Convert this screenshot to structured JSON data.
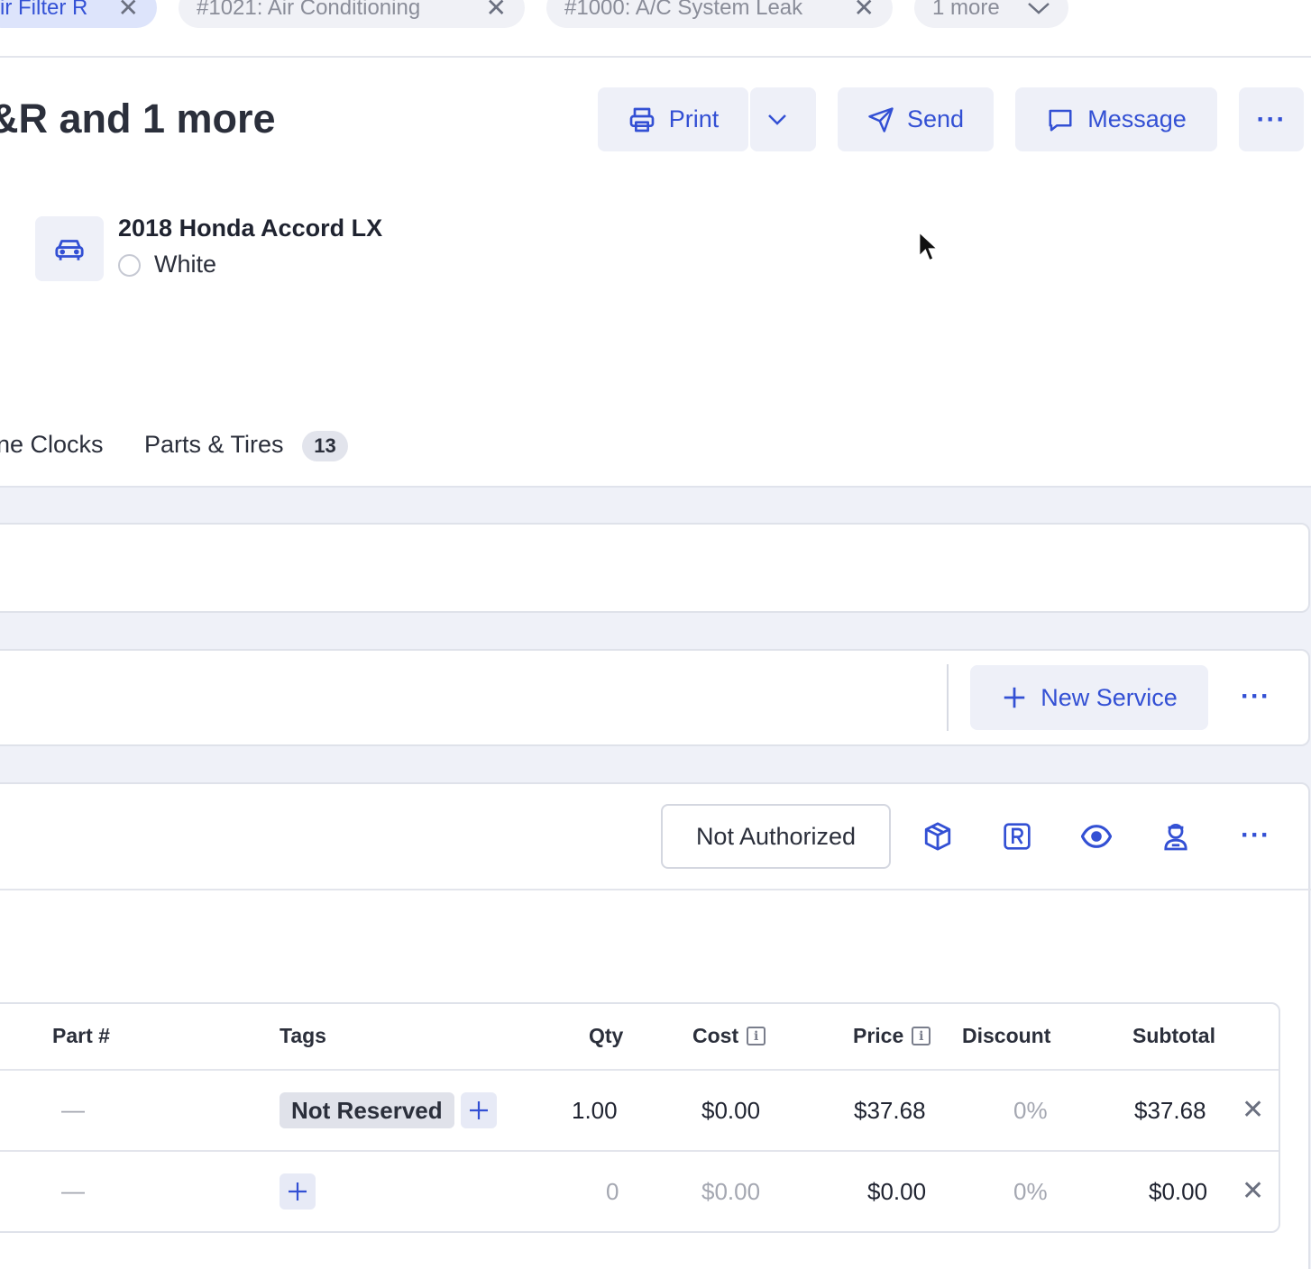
{
  "tabs_bar": {
    "chip1": "ir Filter R",
    "chip2": "#1021: Air Conditioning",
    "chip3": "#1000: A/C System Leak",
    "more": "1 more"
  },
  "header": {
    "title": "&R and 1 more",
    "print_label": "Print",
    "send_label": "Send",
    "message_label": "Message"
  },
  "vehicle": {
    "name": "2018 Honda Accord LX",
    "color": "White"
  },
  "sections": {
    "tab_time_clocks": "ne Clocks",
    "tab_parts_tires": "Parts & Tires",
    "parts_count": "13"
  },
  "services": {
    "new_service_label": "New Service",
    "status_label": "Not Authorized"
  },
  "table": {
    "headers": {
      "part": "Part #",
      "tags": "Tags",
      "qty": "Qty",
      "cost": "Cost",
      "price": "Price",
      "discount": "Discount",
      "subtotal": "Subtotal"
    },
    "rows": [
      {
        "part": "—",
        "tag": "Not Reserved",
        "qty": "1.00",
        "cost": "$0.00",
        "price": "$37.68",
        "discount": "0%",
        "subtotal": "$37.68"
      },
      {
        "part": "—",
        "tag": "",
        "qty": "0",
        "cost": "$0.00",
        "price": "$0.00",
        "discount": "0%",
        "subtotal": "$0.00"
      }
    ]
  },
  "colors": {
    "accent": "#3350d4",
    "chip_active_bg": "#dde4fb",
    "band_bg": "#eff1f8"
  },
  "icons": [
    "close-icon",
    "chevron-down-icon",
    "printer-icon",
    "send-icon",
    "message-icon",
    "more-icon",
    "car-icon",
    "plus-icon",
    "package-icon",
    "r-badge-icon",
    "eye-icon",
    "technician-icon",
    "info-icon"
  ]
}
